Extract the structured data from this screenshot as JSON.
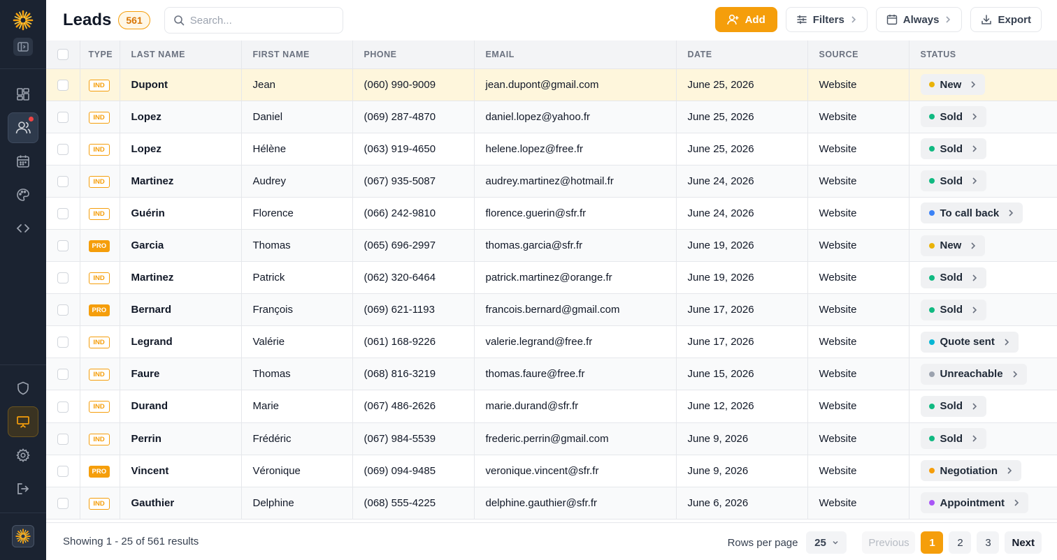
{
  "sidebar": {
    "nav_top": [
      {
        "name": "dashboard-icon",
        "active": false
      },
      {
        "name": "users-icon",
        "active": true,
        "notification": true
      },
      {
        "name": "calendar-icon",
        "active": false
      },
      {
        "name": "palette-icon",
        "active": false
      },
      {
        "name": "code-icon",
        "active": false
      }
    ],
    "nav_bottom": [
      {
        "name": "shield-icon"
      },
      {
        "name": "presentation-icon",
        "active": true
      },
      {
        "name": "gear-icon"
      },
      {
        "name": "logout-icon"
      }
    ]
  },
  "header": {
    "title": "Leads",
    "count": "561",
    "search_placeholder": "Search...",
    "add_label": "Add",
    "filters_label": "Filters",
    "always_label": "Always",
    "export_label": "Export"
  },
  "table": {
    "columns": [
      "TYPE",
      "LAST NAME",
      "FIRST NAME",
      "PHONE",
      "EMAIL",
      "DATE",
      "SOURCE",
      "STATUS"
    ],
    "rows": [
      {
        "type": "IND",
        "last": "Dupont",
        "first": "Jean",
        "phone": "(060) 990-9009",
        "email": "jean.dupont@gmail.com",
        "date": "June 25, 2026",
        "source": "Website",
        "status": "New",
        "dot": "#eab308",
        "highlight": true
      },
      {
        "type": "IND",
        "last": "Lopez",
        "first": "Daniel",
        "phone": "(069) 287-4870",
        "email": "daniel.lopez@yahoo.fr",
        "date": "June 25, 2026",
        "source": "Website",
        "status": "Sold",
        "dot": "#10b981"
      },
      {
        "type": "IND",
        "last": "Lopez",
        "first": "Hélène",
        "phone": "(063) 919-4650",
        "email": "helene.lopez@free.fr",
        "date": "June 25, 2026",
        "source": "Website",
        "status": "Sold",
        "dot": "#10b981"
      },
      {
        "type": "IND",
        "last": "Martinez",
        "first": "Audrey",
        "phone": "(067) 935-5087",
        "email": "audrey.martinez@hotmail.fr",
        "date": "June 24, 2026",
        "source": "Website",
        "status": "Sold",
        "dot": "#10b981"
      },
      {
        "type": "IND",
        "last": "Guérin",
        "first": "Florence",
        "phone": "(066) 242-9810",
        "email": "florence.guerin@sfr.fr",
        "date": "June 24, 2026",
        "source": "Website",
        "status": "To call back",
        "dot": "#3b82f6"
      },
      {
        "type": "PRO",
        "last": "Garcia",
        "first": "Thomas",
        "phone": "(065) 696-2997",
        "email": "thomas.garcia@sfr.fr",
        "date": "June 19, 2026",
        "source": "Website",
        "status": "New",
        "dot": "#eab308"
      },
      {
        "type": "IND",
        "last": "Martinez",
        "first": "Patrick",
        "phone": "(062) 320-6464",
        "email": "patrick.martinez@orange.fr",
        "date": "June 19, 2026",
        "source": "Website",
        "status": "Sold",
        "dot": "#10b981"
      },
      {
        "type": "PRO",
        "last": "Bernard",
        "first": "François",
        "phone": "(069) 621-1193",
        "email": "francois.bernard@gmail.com",
        "date": "June 17, 2026",
        "source": "Website",
        "status": "Sold",
        "dot": "#10b981"
      },
      {
        "type": "IND",
        "last": "Legrand",
        "first": "Valérie",
        "phone": "(061) 168-9226",
        "email": "valerie.legrand@free.fr",
        "date": "June 17, 2026",
        "source": "Website",
        "status": "Quote sent",
        "dot": "#06b6d4"
      },
      {
        "type": "IND",
        "last": "Faure",
        "first": "Thomas",
        "phone": "(068) 816-3219",
        "email": "thomas.faure@free.fr",
        "date": "June 15, 2026",
        "source": "Website",
        "status": "Unreachable",
        "dot": "#9ca3af"
      },
      {
        "type": "IND",
        "last": "Durand",
        "first": "Marie",
        "phone": "(067) 486-2626",
        "email": "marie.durand@sfr.fr",
        "date": "June 12, 2026",
        "source": "Website",
        "status": "Sold",
        "dot": "#10b981"
      },
      {
        "type": "IND",
        "last": "Perrin",
        "first": "Frédéric",
        "phone": "(067) 984-5539",
        "email": "frederic.perrin@gmail.com",
        "date": "June 9, 2026",
        "source": "Website",
        "status": "Sold",
        "dot": "#10b981"
      },
      {
        "type": "PRO",
        "last": "Vincent",
        "first": "Véronique",
        "phone": "(069) 094-9485",
        "email": "veronique.vincent@sfr.fr",
        "date": "June 9, 2026",
        "source": "Website",
        "status": "Negotiation",
        "dot": "#f59e0b"
      },
      {
        "type": "IND",
        "last": "Gauthier",
        "first": "Delphine",
        "phone": "(068) 555-4225",
        "email": "delphine.gauthier@sfr.fr",
        "date": "June 6, 2026",
        "source": "Website",
        "status": "Appointment",
        "dot": "#a855f7"
      }
    ]
  },
  "footer": {
    "showing": "Showing 1 - 25 of 561 results",
    "rows_per_page_label": "Rows per page",
    "rows_per_page_value": "25",
    "previous_label": "Previous",
    "pages": [
      "1",
      "2",
      "3"
    ],
    "next_label": "Next"
  },
  "colors": {
    "accent": "#f59e0b",
    "sidebar": "#1b2331"
  }
}
